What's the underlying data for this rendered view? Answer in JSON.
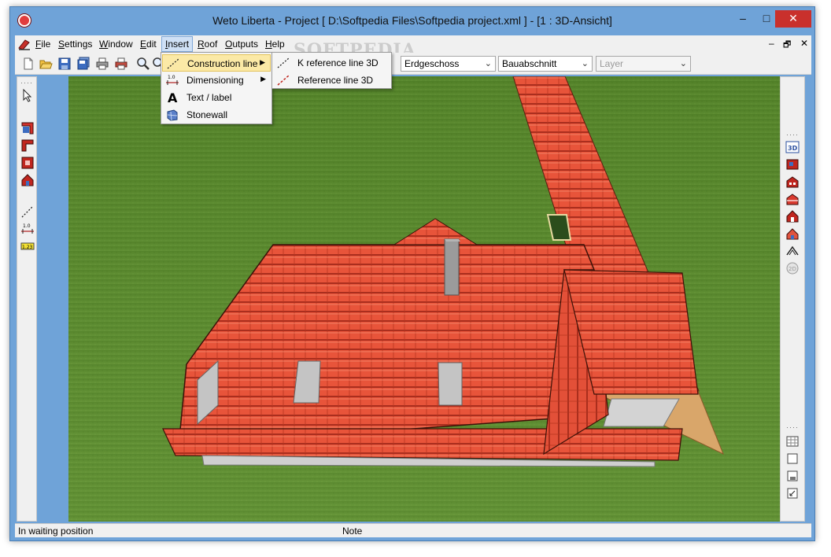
{
  "window": {
    "title": "Weto Liberta - Project [ D:\\Softpedia Files\\Softpedia project.xml ]  - [1 : 3D-Ansicht]",
    "controls": {
      "minimize": "–",
      "maximize": "□",
      "close": "✕"
    }
  },
  "menubar": {
    "items": [
      {
        "label": "File",
        "accel": "F"
      },
      {
        "label": "Settings",
        "accel": "S"
      },
      {
        "label": "Window",
        "accel": "W"
      },
      {
        "label": "Edit",
        "accel": "E"
      },
      {
        "label": "Insert",
        "accel": "I",
        "active": true
      },
      {
        "label": "Roof",
        "accel": "R"
      },
      {
        "label": "Outputs",
        "accel": "O"
      },
      {
        "label": "Help",
        "accel": "H"
      }
    ],
    "mdi_controls": {
      "minimize": "–",
      "restore": "🗗",
      "close": "✕"
    }
  },
  "toolbar": {
    "selects": [
      {
        "value": "Erdgeschoss",
        "enabled": true
      },
      {
        "value": "Bauabschnitt",
        "enabled": true
      },
      {
        "value": "Layer",
        "enabled": false
      }
    ]
  },
  "insert_menu": {
    "items": [
      {
        "label": "Construction line",
        "has_submenu": true,
        "highlighted": true,
        "icon": "construction-line-icon"
      },
      {
        "label": "Dimensioning",
        "has_submenu": true,
        "highlighted": false,
        "icon": "dimensioning-icon"
      },
      {
        "label": "Text / label",
        "has_submenu": false,
        "highlighted": false,
        "icon": "text-label-icon"
      },
      {
        "label": "Stonewall",
        "has_submenu": false,
        "highlighted": false,
        "icon": "stonewall-icon"
      }
    ]
  },
  "construction_submenu": {
    "items": [
      {
        "label": "K reference line 3D",
        "icon": "k-reference-line-icon"
      },
      {
        "label": "Reference line 3D",
        "icon": "reference-line-icon"
      }
    ]
  },
  "watermark": "SOFTPEDIA",
  "statusbar": {
    "state": "In waiting position",
    "note": "Note"
  },
  "colors": {
    "frame": "#6fa3d8",
    "ground": "#5a8a2f",
    "roof_tile": "#e8543a",
    "menu_highlight": "#fbe9a6"
  }
}
